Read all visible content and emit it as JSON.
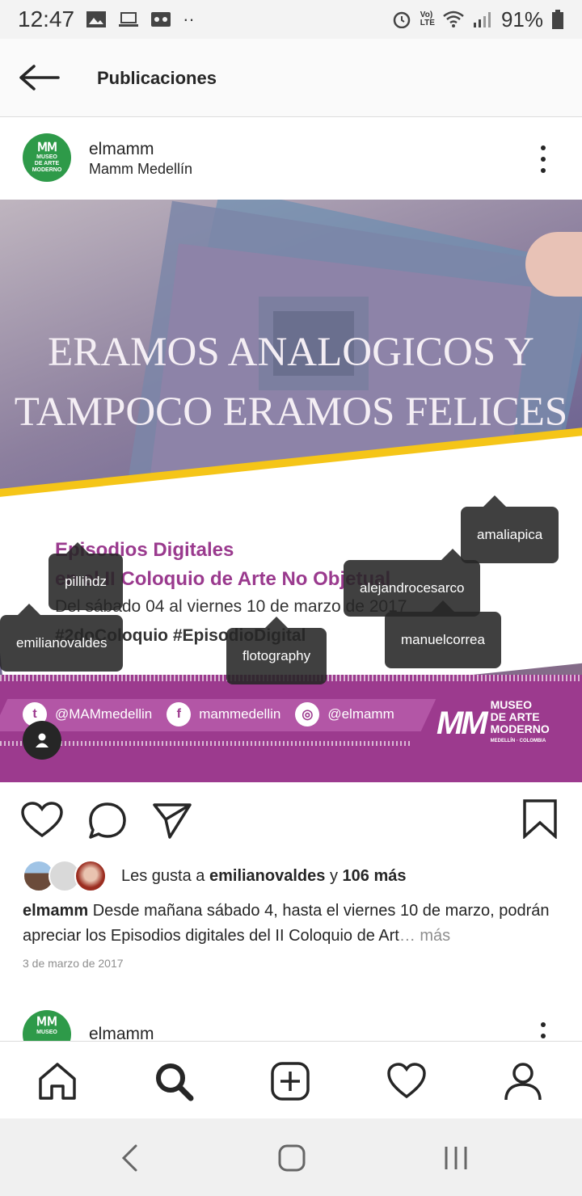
{
  "status_bar": {
    "time": "12:47",
    "dots": "··",
    "net1": "Vo)",
    "net2": "LTE",
    "battery": "91%"
  },
  "header": {
    "title": "Publicaciones"
  },
  "post": {
    "username": "elmamm",
    "subtitle": "Mamm Medellín",
    "avatar_lines": [
      "MUSEO",
      "DE ARTE",
      "MODERNO"
    ],
    "image": {
      "headline_line1": "ERAMOS ANALOGICOS Y",
      "headline_line2": "TAMPOCO ERAMOS FELICES",
      "event_title": "Episodios Digitales",
      "event_line2": "en el II Coloquio de Arte No Objetual",
      "event_dates": "Del sábado 04 al viernes 10 de marzo de 2017",
      "event_tags": "#2doColoquio #EpisodioDigital",
      "social": [
        {
          "icon": "twitter-icon",
          "handle": "@MAMmedellin"
        },
        {
          "icon": "facebook-icon",
          "handle": "mammedellin"
        },
        {
          "icon": "instagram-icon",
          "handle": "@elmamm"
        }
      ],
      "museum_logo": {
        "mark": "MM",
        "line1": "MUSEO",
        "line2": "DE ARTE",
        "line3": "MODERNO",
        "line4": "MEDELLÍN · COLOMBIA"
      }
    },
    "tags": [
      "amaliapica",
      "pillihdz",
      "alejandrocesarco",
      "emilianovaldes",
      "flotography",
      "manuelcorrea"
    ],
    "likes": {
      "prefix": "Les gusta a",
      "user": "emilianovaldes",
      "joiner": "y",
      "count": "106 más"
    },
    "caption": {
      "user": "elmamm",
      "text": "Desde mañana sábado 4, hasta el viernes 10 de marzo, podrán apreciar los Episodios digitales del II Coloquio de Art",
      "more": "… más"
    },
    "date": "3 de marzo de 2017"
  },
  "next_post": {
    "username": "elmamm"
  },
  "colors": {
    "accent_purple": "#9c3a8e",
    "museum_green": "#2e9a49",
    "stripe_yellow": "#f5c518"
  }
}
